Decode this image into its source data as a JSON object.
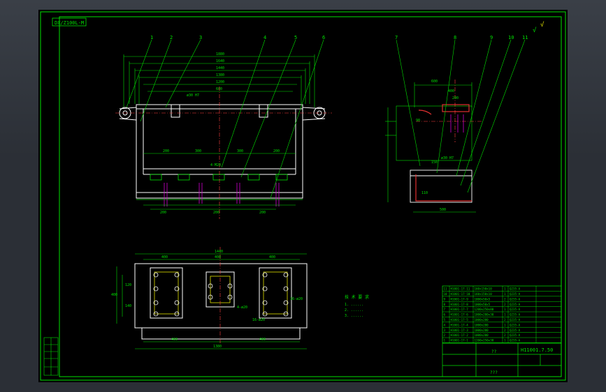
{
  "drawing": {
    "stamp": "DX/Z100L-M",
    "drawing_number": "H11001.7.50",
    "title_mark": "??",
    "approval_mark": "???",
    "roughness_note": "√"
  },
  "front_view": {
    "balloons": [
      "1",
      "2",
      "3",
      "4",
      "5",
      "6"
    ],
    "dims_top": [
      "1880",
      "1640",
      "1440",
      "1380",
      "1200",
      "600"
    ],
    "dims_inner": [
      "200",
      "300",
      "300",
      "200"
    ],
    "dims_bottom": [
      "200",
      "200",
      "200"
    ],
    "callout_hole": "ø30 H7",
    "callout_thread": "4-M20"
  },
  "side_view": {
    "balloons": [
      "7",
      "8",
      "9",
      "10",
      "11"
    ],
    "dims": [
      "600",
      "400",
      "200",
      "90",
      "150",
      "110",
      "500"
    ],
    "callout": "ø30 H7"
  },
  "plan_view": {
    "dims_top": [
      "1440",
      "400",
      "400",
      "400"
    ],
    "dims_bottom": [
      "400",
      "400",
      "1380"
    ],
    "dims_side": [
      "400",
      "120",
      "140"
    ],
    "callouts": [
      "4-ø20",
      "16-ø20",
      "16-ø20"
    ]
  },
  "tech_notes": {
    "header": "技 术 要 求",
    "lines": [
      "1. ......",
      "2. ......",
      "3. ......"
    ]
  },
  "parts_list": {
    "rows": [
      [
        "11",
        "H1001-17-11",
        "160x150x10",
        "1",
        "Q235-A"
      ],
      [
        "10",
        "H1001-17-10",
        "160x150x10",
        "1",
        "Q235-A"
      ],
      [
        "9",
        "H1001-17-9",
        "1000x50x5",
        "2",
        "Q235-A"
      ],
      [
        "8",
        "H1001-17-8",
        "1000x50x5",
        "2",
        "Q235-A"
      ],
      [
        "7",
        "H1001-17-7",
        "1200x250x80",
        "1",
        "Q235-A"
      ],
      [
        "6",
        "H1001-17-6",
        "1000x200x30",
        "1",
        "Q235-A"
      ],
      [
        "5",
        "H1001-17-5",
        "1000x200",
        "2",
        "Q235-A"
      ],
      [
        "4",
        "H1001-17-4",
        "1000x200",
        "1",
        "Q235-A"
      ],
      [
        "3",
        "H1001-17-3",
        "1000x200",
        "2",
        "Q235-A"
      ],
      [
        "2",
        "H1001-17-2",
        "1000x200",
        "2",
        "Q235-A"
      ],
      [
        "1",
        "H1001-17-1",
        "1200x250x38",
        "1",
        "Q235-A"
      ]
    ]
  },
  "colors": {
    "line": "#00e000",
    "white": "#ffffff",
    "red": "#e03030",
    "magenta": "#d000d0",
    "cyan": "#00d0d0",
    "yellow": "#e0e000",
    "center": "#ff4040"
  }
}
